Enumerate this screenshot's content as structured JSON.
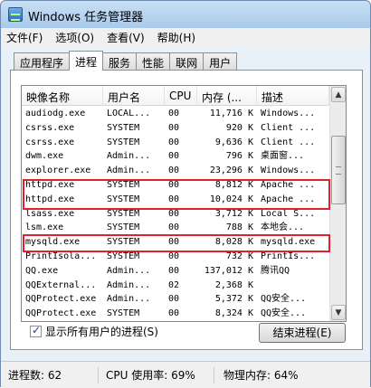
{
  "window": {
    "title": "Windows 任务管理器"
  },
  "menu": [
    "文件(F)",
    "选项(O)",
    "查看(V)",
    "帮助(H)"
  ],
  "tabs": [
    "应用程序",
    "进程",
    "服务",
    "性能",
    "联网",
    "用户"
  ],
  "active_tab": "进程",
  "columns": [
    "映像名称",
    "用户名",
    "CPU",
    "内存 (...",
    "描述"
  ],
  "processes": [
    [
      "audiodg.exe",
      "LOCAL...",
      "00",
      "11,716 K",
      "Windows..."
    ],
    [
      "csrss.exe",
      "SYSTEM",
      "00",
      "920 K",
      "Client ..."
    ],
    [
      "csrss.exe",
      "SYSTEM",
      "00",
      "9,636 K",
      "Client ..."
    ],
    [
      "dwm.exe",
      "Admin...",
      "00",
      "796 K",
      "桌面窗..."
    ],
    [
      "explorer.exe",
      "Admin...",
      "00",
      "23,296 K",
      "Windows..."
    ],
    [
      "httpd.exe",
      "SYSTEM",
      "00",
      "8,812 K",
      "Apache ..."
    ],
    [
      "httpd.exe",
      "SYSTEM",
      "00",
      "10,024 K",
      "Apache ..."
    ],
    [
      "lsass.exe",
      "SYSTEM",
      "00",
      "3,712 K",
      "Local S..."
    ],
    [
      "lsm.exe",
      "SYSTEM",
      "00",
      "788 K",
      "本地会..."
    ],
    [
      "mysqld.exe",
      "SYSTEM",
      "00",
      "8,028 K",
      "mysqld.exe"
    ],
    [
      "PrintIsola...",
      "SYSTEM",
      "00",
      "732 K",
      "PrintIs..."
    ],
    [
      "QQ.exe",
      "Admin...",
      "00",
      "137,012 K",
      "腾讯QQ"
    ],
    [
      "QQExternal...",
      "Admin...",
      "02",
      "2,368 K",
      ""
    ],
    [
      "QQProtect.exe",
      "Admin...",
      "00",
      "5,372 K",
      "QQ安全..."
    ],
    [
      "QQProtect.exe",
      "SYSTEM",
      "00",
      "8,324 K",
      "QQ安全..."
    ]
  ],
  "show_all_label": "显示所有用户的进程(S)",
  "show_all_checked": true,
  "end_process_label": "结束进程(E)",
  "status": {
    "processes": "进程数: 62",
    "cpu": "CPU 使用率: 69%",
    "memory": "物理内存: 64%"
  },
  "highlight_color": "#e0202a"
}
